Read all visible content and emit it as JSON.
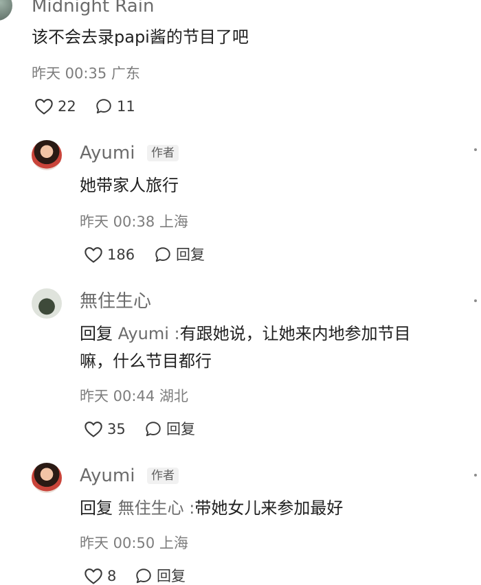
{
  "comments": [
    {
      "user": "Midnight Rain",
      "text": "该不会去录papi酱的节目了吧",
      "time": "昨天 00:35",
      "location": "广东",
      "likes": "22",
      "replies": "11"
    },
    {
      "user": "Ayumi",
      "badge": "作者",
      "text": "她带家人旅行",
      "time": "昨天 00:38",
      "location": "上海",
      "likes": "186",
      "reply_label": "回复"
    },
    {
      "user": "無住生心",
      "reply_prefix": "回复",
      "reply_target": "Ayumi :",
      "text_line1": "有跟她说，让她来内地参加节目",
      "text_line2": "嘛，什么节目都行",
      "time": "昨天 00:44",
      "location": "湖北",
      "likes": "35",
      "reply_label": "回复"
    },
    {
      "user": "Ayumi",
      "badge": "作者",
      "reply_prefix": "回复",
      "reply_target": "無住生心 :",
      "text": "带她女儿来参加最好",
      "time": "昨天 00:50",
      "location": "上海",
      "likes": "8",
      "reply_label": "回复"
    }
  ],
  "icons": {
    "like": "heart-outline-icon",
    "comment": "speech-bubble-icon",
    "more": "more-vertical-icon"
  },
  "colors": {
    "text": "#1f1f1f",
    "secondary": "#7d7d7d",
    "badge_bg": "#f1f1f1"
  }
}
